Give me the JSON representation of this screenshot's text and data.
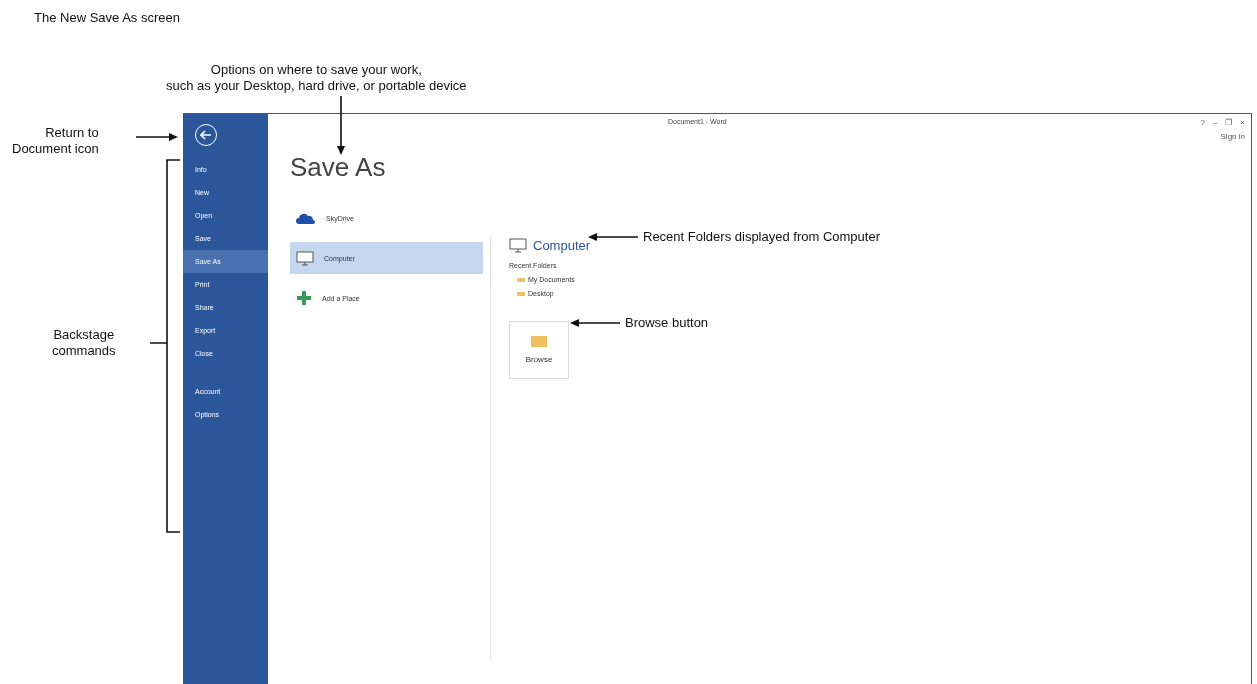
{
  "figure": {
    "caption": "The New Save As screen",
    "callouts": [
      {
        "kind": "top",
        "lines": [
          "Options on where to save your work,",
          "such as your Desktop, hard drive, or portable device"
        ]
      },
      {
        "kind": "back",
        "lines": [
          "Return to",
          "Document icon"
        ]
      },
      {
        "kind": "bracket",
        "lines": [
          "Backstage",
          "commands"
        ]
      },
      {
        "kind": "recent",
        "lines": [
          "Recent Folders displayed from Computer"
        ]
      },
      {
        "kind": "browse",
        "lines": [
          "Browse button"
        ]
      }
    ]
  },
  "window": {
    "title": "Document1 - Word",
    "controls": [
      "?",
      "–",
      "❐",
      "×"
    ],
    "sign_in": "Sign in"
  },
  "sidebar": {
    "items": [
      {
        "label": "Info",
        "selected": false
      },
      {
        "label": "New",
        "selected": false
      },
      {
        "label": "Open",
        "selected": false
      },
      {
        "label": "Save",
        "selected": false
      },
      {
        "label": "Save As",
        "selected": true
      },
      {
        "label": "Print",
        "selected": false
      },
      {
        "label": "Share",
        "selected": false
      },
      {
        "label": "Export",
        "selected": false
      },
      {
        "label": "Close",
        "selected": false
      },
      {
        "label": "Account",
        "selected": false,
        "kind": "lower"
      },
      {
        "label": "Options",
        "selected": false,
        "kind": "lower"
      }
    ]
  },
  "heading": "Save As",
  "places": [
    {
      "kind": "cloud",
      "label": "SkyDrive",
      "selected": false
    },
    {
      "kind": "computer",
      "label": "Computer",
      "selected": true
    },
    {
      "kind": "add",
      "label": "Add a Place",
      "selected": false
    }
  ],
  "detail": {
    "title": "Computer",
    "recent_label": "Recent Folders",
    "folders": [
      "My Documents",
      "Desktop"
    ],
    "browse": "Browse"
  }
}
